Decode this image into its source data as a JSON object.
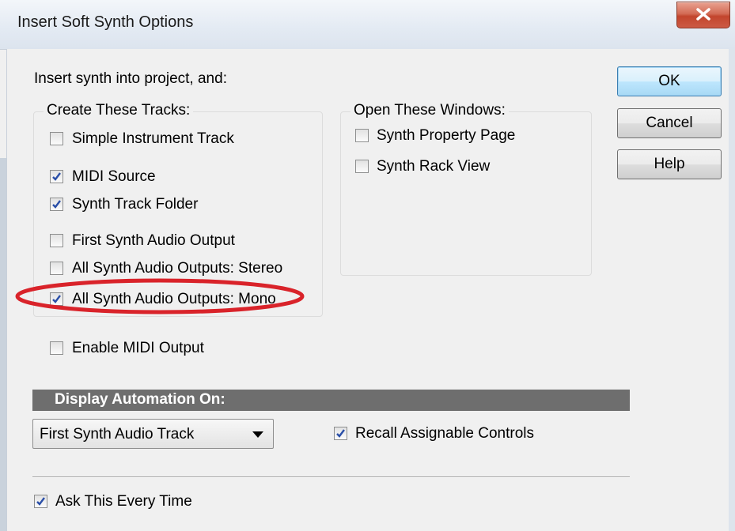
{
  "window": {
    "title": "Insert Soft Synth Options",
    "close_symbol": "x"
  },
  "intro": "Insert synth into project, and:",
  "create_tracks": {
    "label": "Create These Tracks:",
    "options": [
      {
        "label": "Simple Instrument Track",
        "checked": false
      },
      {
        "label": "MIDI Source",
        "checked": true
      },
      {
        "label": "Synth Track Folder",
        "checked": true
      },
      {
        "label": "First Synth Audio Output",
        "checked": false
      },
      {
        "label": "All Synth Audio Outputs: Stereo",
        "checked": false
      },
      {
        "label": "All Synth Audio Outputs: Mono",
        "checked": true
      }
    ]
  },
  "enable_midi_output": {
    "label": "Enable MIDI Output",
    "checked": false
  },
  "open_windows": {
    "label": "Open These Windows:",
    "options": [
      {
        "label": "Synth Property Page",
        "checked": false
      },
      {
        "label": "Synth Rack View",
        "checked": false
      }
    ]
  },
  "buttons": {
    "ok": "OK",
    "cancel": "Cancel",
    "help": "Help"
  },
  "display_automation": {
    "heading": "Display Automation On:",
    "selected": "First Synth Audio Track"
  },
  "recall_assignable_controls": {
    "label": "Recall Assignable Controls",
    "checked": true
  },
  "ask_every_time": {
    "label": "Ask This Every Time",
    "checked": true
  },
  "colors": {
    "annotation_ellipse": "#d9232a",
    "section_bar": "#6e6e6e",
    "check_blue": "#2a4fa8"
  }
}
